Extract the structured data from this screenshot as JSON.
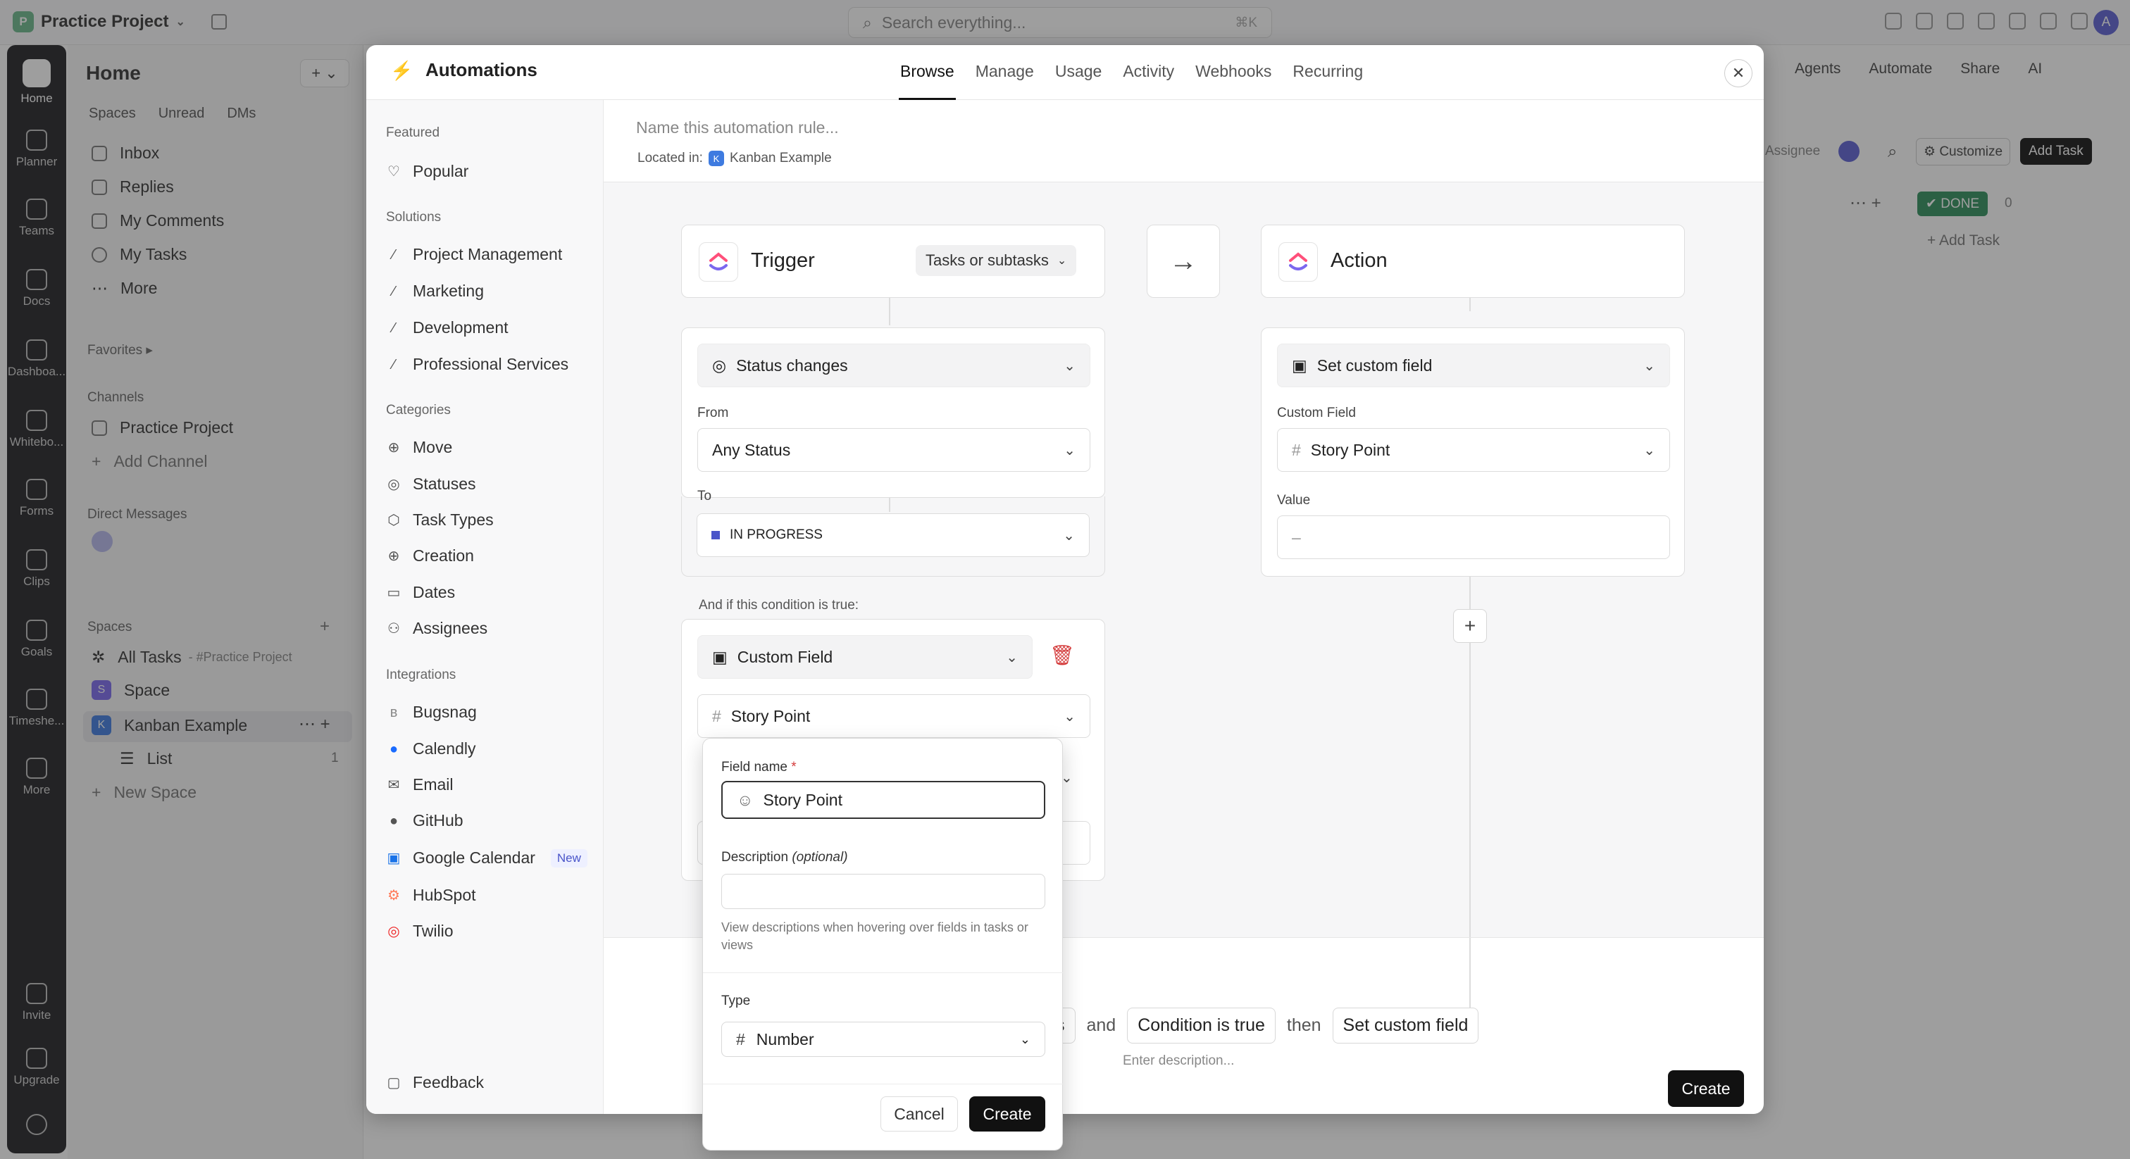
{
  "topbar": {
    "project_badge": "P",
    "project_name": "Practice Project",
    "search_placeholder": "Search everything...",
    "search_shortcut": "⌘K",
    "user_initial": "A"
  },
  "rail": {
    "items": [
      "Home",
      "Planner",
      "Teams",
      "Docs",
      "Dashboa...",
      "Whitebo...",
      "Forms",
      "Clips",
      "Goals",
      "Timeshe...",
      "More",
      "Invite",
      "Upgrade"
    ]
  },
  "sidebar": {
    "title": "Home",
    "tabs": [
      "Spaces",
      "Unread",
      "DMs"
    ],
    "nav": [
      "Inbox",
      "Replies",
      "My Comments",
      "My Tasks",
      "More"
    ],
    "favorites": "Favorites",
    "channels_head": "Channels",
    "channel": "Practice Project",
    "add_channel": "Add Channel",
    "dm_head": "Direct Messages",
    "spaces_head": "Spaces",
    "all_tasks": "All Tasks",
    "all_tasks_sub": "- #Practice Project",
    "space": "Space",
    "space_badge": "S",
    "kanban": "Kanban Example",
    "kanban_badge": "K",
    "list": "List",
    "list_count": "1",
    "new_space": "New Space"
  },
  "background": {
    "agents": "Agents",
    "automate": "Automate",
    "share": "Share",
    "ai": "AI",
    "assignee": "Assignee",
    "customize": "Customize",
    "add_task_btn": "Add Task",
    "done": "DONE",
    "done_count": "0",
    "add_task": "+ Add Task"
  },
  "modal": {
    "title": "Automations",
    "tabs": [
      "Browse",
      "Manage",
      "Usage",
      "Activity",
      "Webhooks",
      "Recurring"
    ],
    "nav": {
      "featured_head": "Featured",
      "popular": "Popular",
      "solutions_head": "Solutions",
      "solutions": [
        "Project Management",
        "Marketing",
        "Development",
        "Professional Services"
      ],
      "categories_head": "Categories",
      "categories": [
        "Move",
        "Statuses",
        "Task Types",
        "Creation",
        "Dates",
        "Assignees"
      ],
      "integrations_head": "Integrations",
      "integrations": [
        "Bugsnag",
        "Calendly",
        "Email",
        "GitHub",
        "Google Calendar",
        "HubSpot",
        "Twilio"
      ],
      "new_badge": "New",
      "feedback": "Feedback"
    },
    "builder": {
      "rule_name_placeholder": "Name this automation rule...",
      "located_label": "Located in:",
      "located_badge": "K",
      "located_value": "Kanban Example",
      "trigger": {
        "title": "Trigger",
        "scope": "Tasks or subtasks",
        "event": "Status changes",
        "from_label": "From",
        "from_value": "Any Status",
        "to_label": "To",
        "to_value": "IN PROGRESS",
        "to_color": "#4a55c9"
      },
      "condition": {
        "intro": "And if this condition is true:",
        "type": "Custom Field",
        "field": "Story Point"
      },
      "action": {
        "title": "Action",
        "type": "Set custom field",
        "field_label": "Custom Field",
        "field_value": "Story Point",
        "value_label": "Value",
        "value_placeholder": "–"
      },
      "summary": {
        "partial": "s",
        "and": "and",
        "condition": "Condition is true",
        "then": "then",
        "action": "Set custom field",
        "desc_placeholder": "Enter description..."
      },
      "create": "Create"
    },
    "popover": {
      "field_name_label": "Field name",
      "required_mark": "*",
      "field_name_value": "Story Point",
      "description_label": "Description",
      "optional": "(optional)",
      "description_value": "",
      "help": "View descriptions when hovering over fields in tasks or views",
      "type_label": "Type",
      "type_value": "Number",
      "cancel": "Cancel",
      "create": "Create"
    }
  }
}
